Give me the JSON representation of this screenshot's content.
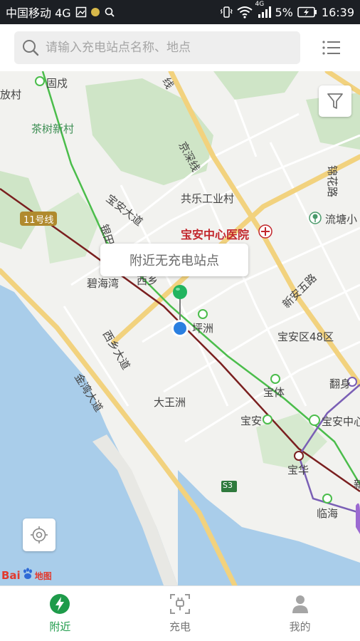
{
  "status_bar": {
    "carrier": "中国移动 4G",
    "net_badge": "4G",
    "battery": "5%",
    "time": "16:39"
  },
  "search": {
    "placeholder": "请输入充电站点名称、地点"
  },
  "map": {
    "popup_text": "附近无充电站点",
    "labels": {
      "fangcun": "放村",
      "guxu": "固戍",
      "chashu": "茶树新村",
      "jingshen_top": "线",
      "jingshen": "京深线",
      "jinhua": "锦花路",
      "baoan_dadao": "宝安大道",
      "gongle": "共乐工业村",
      "liutang": "流塘小",
      "line11": "11号线",
      "yintian": "银田路",
      "hospital": "宝安中心医院",
      "bihaiwan": "碧海湾",
      "xixiang": "西乡",
      "xinanwu": "新安五路",
      "pingzhou": "坪洲",
      "baoan48": "宝安区48区",
      "xixiang_dadao": "西乡大道",
      "jinqiao": "金湾大道",
      "baoti": "宝体",
      "fanshen": "翻身",
      "dawangzhou": "大王洲",
      "baoan_station": "宝安",
      "baoan_center": "宝安中心",
      "baohua": "宝华",
      "s3": "S3",
      "linhai": "临海",
      "xin": "新"
    }
  },
  "baidu": {
    "text_left": "Bai",
    "text_right": "地图"
  },
  "nav": [
    {
      "label": "附近",
      "icon": "bolt-icon",
      "active": true
    },
    {
      "label": "充电",
      "icon": "scan-plug-icon",
      "active": false
    },
    {
      "label": "我的",
      "icon": "user-icon",
      "active": false
    }
  ],
  "colors": {
    "accent": "#1e9b4a",
    "metro_green": "#4bbd4b",
    "metro_red": "#7a1f1f",
    "road_yellow": "#f2d27e",
    "water": "#a9cdea",
    "park": "#cfe5c7"
  }
}
